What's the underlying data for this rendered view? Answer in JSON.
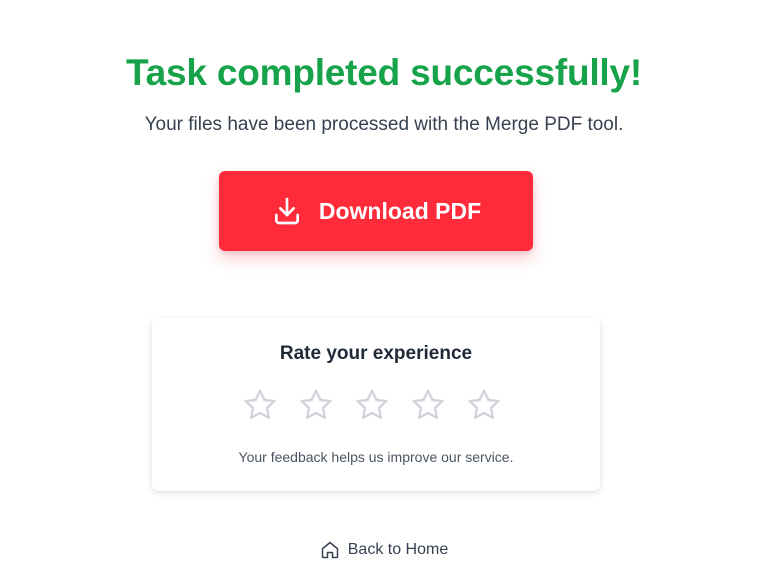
{
  "header": {
    "title": "Task completed successfully!",
    "subtitle": "Your files have been processed with the Merge PDF tool."
  },
  "download": {
    "label": "Download PDF",
    "icon": "download-icon"
  },
  "rating": {
    "title": "Rate your experience",
    "stars_total": 5,
    "stars_selected": 0,
    "note": "Your feedback helps us improve our service."
  },
  "footer": {
    "back_label": "Back to Home",
    "icon": "home-icon"
  },
  "colors": {
    "success": "#16a34a",
    "accent": "#ff2a3a",
    "star_outline": "#d1d5db",
    "text": "#374151"
  }
}
